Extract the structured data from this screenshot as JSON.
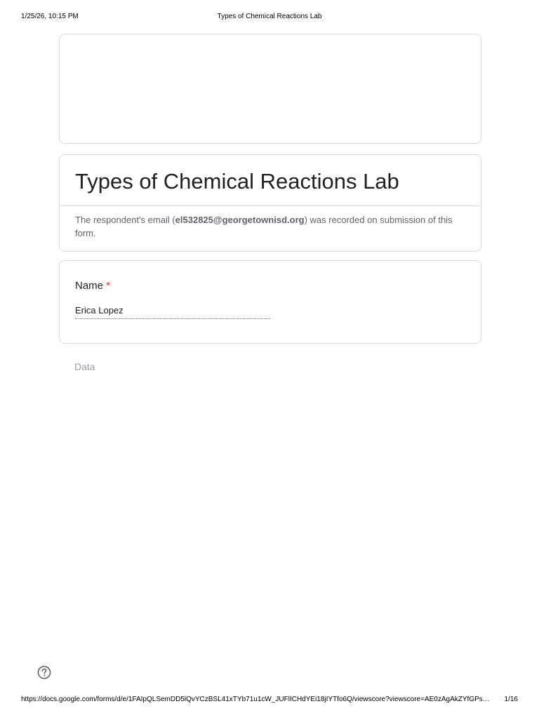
{
  "print_header": {
    "datetime": "1/25/26, 10:15 PM",
    "document_title": "Types of Chemical Reactions Lab"
  },
  "form": {
    "title": "Types of Chemical Reactions Lab",
    "email_note": {
      "prefix": "The respondent's email (",
      "email": "el532825@georgetownisd.org",
      "suffix": ") was recorded on submission of this form."
    },
    "questions": [
      {
        "title": "Name",
        "required_marker": "*",
        "answer": "Erica Lopez"
      }
    ],
    "next_section_label": "Data"
  },
  "icons": {
    "help": "help-circle-icon"
  },
  "print_footer": {
    "url": "https://docs.google.com/forms/d/e/1FAIpQLSemDD5lQvYCzBSL41xTYb71u1cW_JUFlICHdYEi18jIYTfo6Q/viewscore?viewscore=AE0zAgAkZYfGPs…",
    "page": "1/16"
  },
  "colors": {
    "required": "#d93025",
    "border": "#dadce0",
    "muted_text": "#5f6368"
  }
}
